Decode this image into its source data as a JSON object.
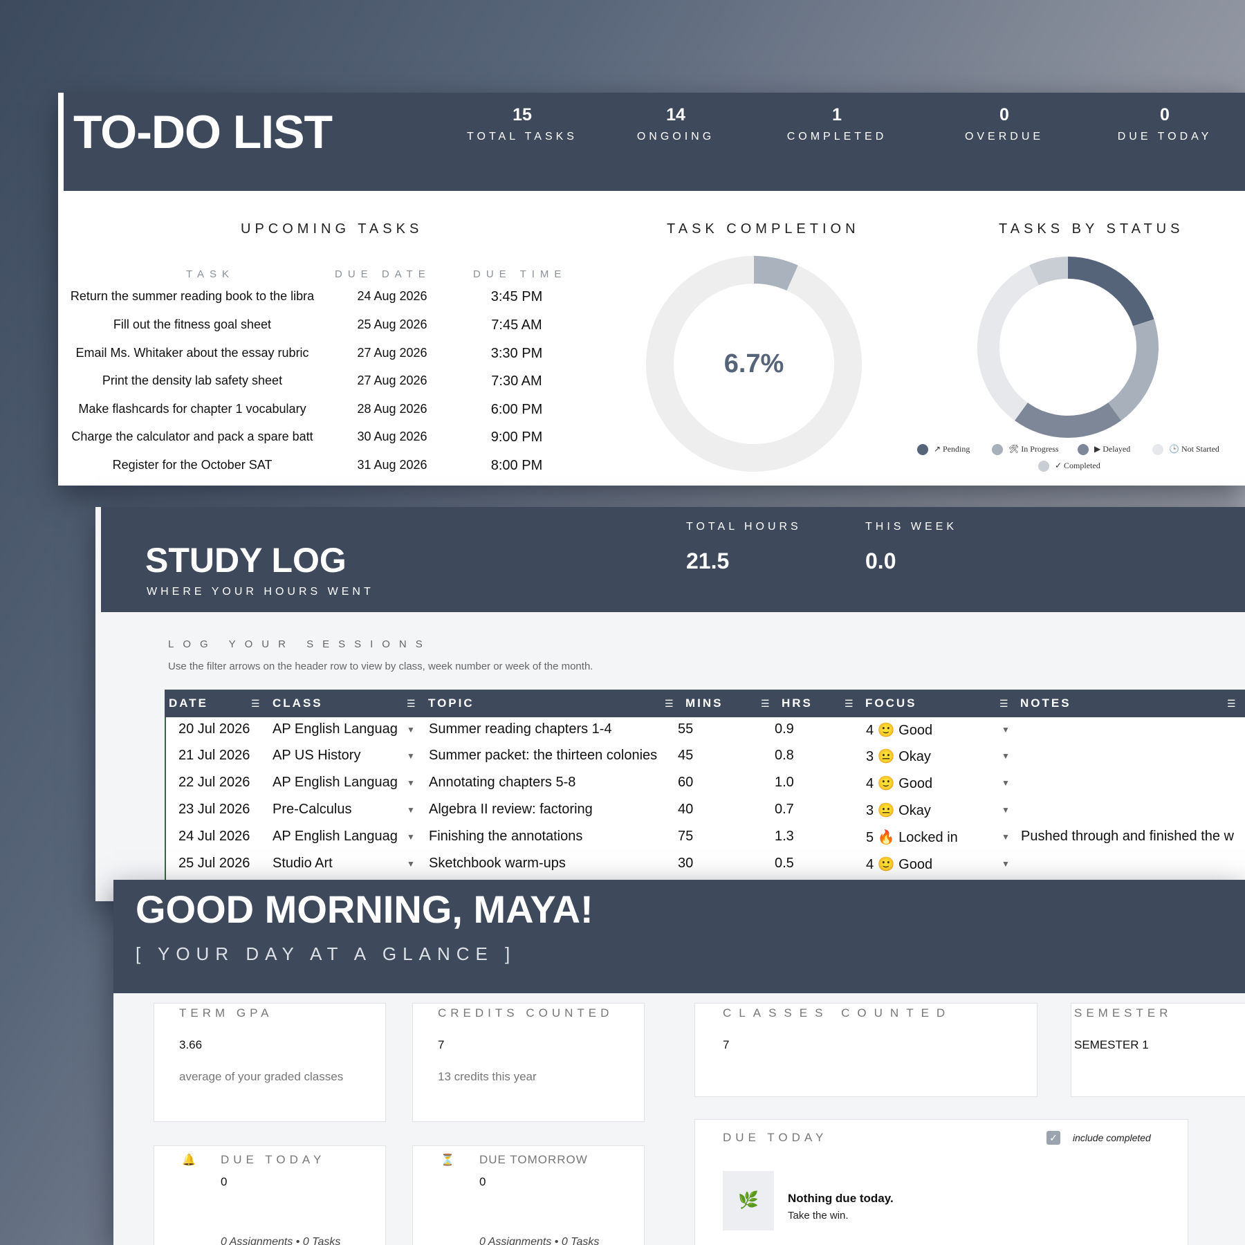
{
  "todo": {
    "title": "TO-DO LIST",
    "kpis": [
      {
        "value": "15",
        "label": "TOTAL TASKS"
      },
      {
        "value": "14",
        "label": "ONGOING"
      },
      {
        "value": "1",
        "label": "COMPLETED"
      },
      {
        "value": "0",
        "label": "OVERDUE"
      },
      {
        "value": "0",
        "label": "DUE TODAY"
      }
    ],
    "upcoming": {
      "heading": "UPCOMING TASKS",
      "columns": [
        "TASK",
        "DUE DATE",
        "DUE TIME"
      ],
      "rows": [
        {
          "task": "Return the summer reading book to the libra",
          "date": "24 Aug 2026",
          "time": "3:45 PM"
        },
        {
          "task": "Fill out the fitness goal sheet",
          "date": "25 Aug 2026",
          "time": "7:45 AM"
        },
        {
          "task": "Email Ms. Whitaker about the essay rubric",
          "date": "27 Aug 2026",
          "time": "3:30 PM"
        },
        {
          "task": "Print the density lab safety sheet",
          "date": "27 Aug 2026",
          "time": "7:30 AM"
        },
        {
          "task": "Make flashcards for chapter 1 vocabulary",
          "date": "28 Aug 2026",
          "time": "6:00 PM"
        },
        {
          "task": "Charge the calculator and pack a spare batt",
          "date": "30 Aug 2026",
          "time": "9:00 PM"
        },
        {
          "task": "Register for the October SAT",
          "date": "31 Aug 2026",
          "time": "8:00 PM"
        }
      ]
    },
    "completion": {
      "heading": "TASK COMPLETION",
      "value_label": "6.7%",
      "fraction": 0.067,
      "colors": {
        "done": "#a9b2bd",
        "rest": "#eeeeee",
        "text": "#56647a"
      }
    },
    "status": {
      "heading": "TASKS BY STATUS",
      "slices": [
        {
          "label": "↗ Pending",
          "share": 0.2,
          "color": "#56647a"
        },
        {
          "label": "🛠 In Progress",
          "share": 0.2,
          "color": "#a7b0bb"
        },
        {
          "label": "▶ Delayed",
          "share": 0.2,
          "color": "#7d8797"
        },
        {
          "label": "🕒 Not Started",
          "share": 0.33,
          "color": "#e6e8ec"
        },
        {
          "label": "✓ Completed",
          "share": 0.07,
          "color": "#c9ced5"
        }
      ]
    }
  },
  "study": {
    "title": "STUDY LOG",
    "subtitle": "WHERE YOUR HOURS WENT",
    "kpis": [
      {
        "label": "TOTAL HOURS",
        "value": "21.5"
      },
      {
        "label": "THIS WEEK",
        "value": "0.0"
      }
    ],
    "log_heading": "LOG YOUR SESSIONS",
    "log_hint": "Use the filter arrows on the header row to view by class, week number or week of the month.",
    "columns": [
      "DATE",
      "CLASS",
      "TOPIC",
      "MINS",
      "HRS",
      "FOCUS",
      "NOTES"
    ],
    "rows": [
      {
        "date": "20 Jul 2026",
        "class": "AP English Languag",
        "topic": "Summer reading chapters 1-4",
        "mins": "55",
        "hrs": "0.9",
        "focus": "4 🙂 Good",
        "notes": ""
      },
      {
        "date": "21 Jul 2026",
        "class": "AP US History",
        "topic": "Summer packet: the thirteen colonies",
        "mins": "45",
        "hrs": "0.8",
        "focus": "3 😐 Okay",
        "notes": ""
      },
      {
        "date": "22 Jul 2026",
        "class": "AP English Languag",
        "topic": "Annotating chapters 5-8",
        "mins": "60",
        "hrs": "1.0",
        "focus": "4 🙂 Good",
        "notes": ""
      },
      {
        "date": "23 Jul 2026",
        "class": "Pre-Calculus",
        "topic": "Algebra II review: factoring",
        "mins": "40",
        "hrs": "0.7",
        "focus": "3 😐 Okay",
        "notes": ""
      },
      {
        "date": "24 Jul 2026",
        "class": "AP English Languag",
        "topic": "Finishing the annotations",
        "mins": "75",
        "hrs": "1.3",
        "focus": "5 🔥 Locked in",
        "notes": "Pushed through and finished the w"
      },
      {
        "date": "25 Jul 2026",
        "class": "Studio Art",
        "topic": "Sketchbook warm-ups",
        "mins": "30",
        "hrs": "0.5",
        "focus": "4 🙂 Good",
        "notes": ""
      }
    ]
  },
  "greeting": {
    "title": "GOOD MORNING, MAYA!",
    "subtitle": "[ YOUR DAY AT A GLANCE ]",
    "gpa": {
      "label": "TERM GPA",
      "value": "3.66",
      "sub": "average of your graded classes"
    },
    "credits": {
      "label": "CREDITS COUNTED",
      "value": "7",
      "sub": "13 credits this year"
    },
    "classes": {
      "label": "CLASSES COUNTED",
      "value": "7"
    },
    "semester": {
      "label": "SEMESTER",
      "value": "SEMESTER 1"
    },
    "due_today_card": {
      "icon": "🔔",
      "label": "DUE TODAY",
      "value": "0",
      "foot": "0 Assignments  •  0 Tasks"
    },
    "due_tomorrow_card": {
      "icon": "⏳",
      "label": "DUE TOMORROW",
      "value": "0",
      "foot": "0 Assignments  •  0 Tasks"
    },
    "due_today_panel": {
      "label": "DUE TODAY",
      "checkbox_label": "include completed",
      "checked": true,
      "empty_icon": "🌿",
      "empty_title": "Nothing due today.",
      "empty_sub": "Take the win."
    }
  }
}
